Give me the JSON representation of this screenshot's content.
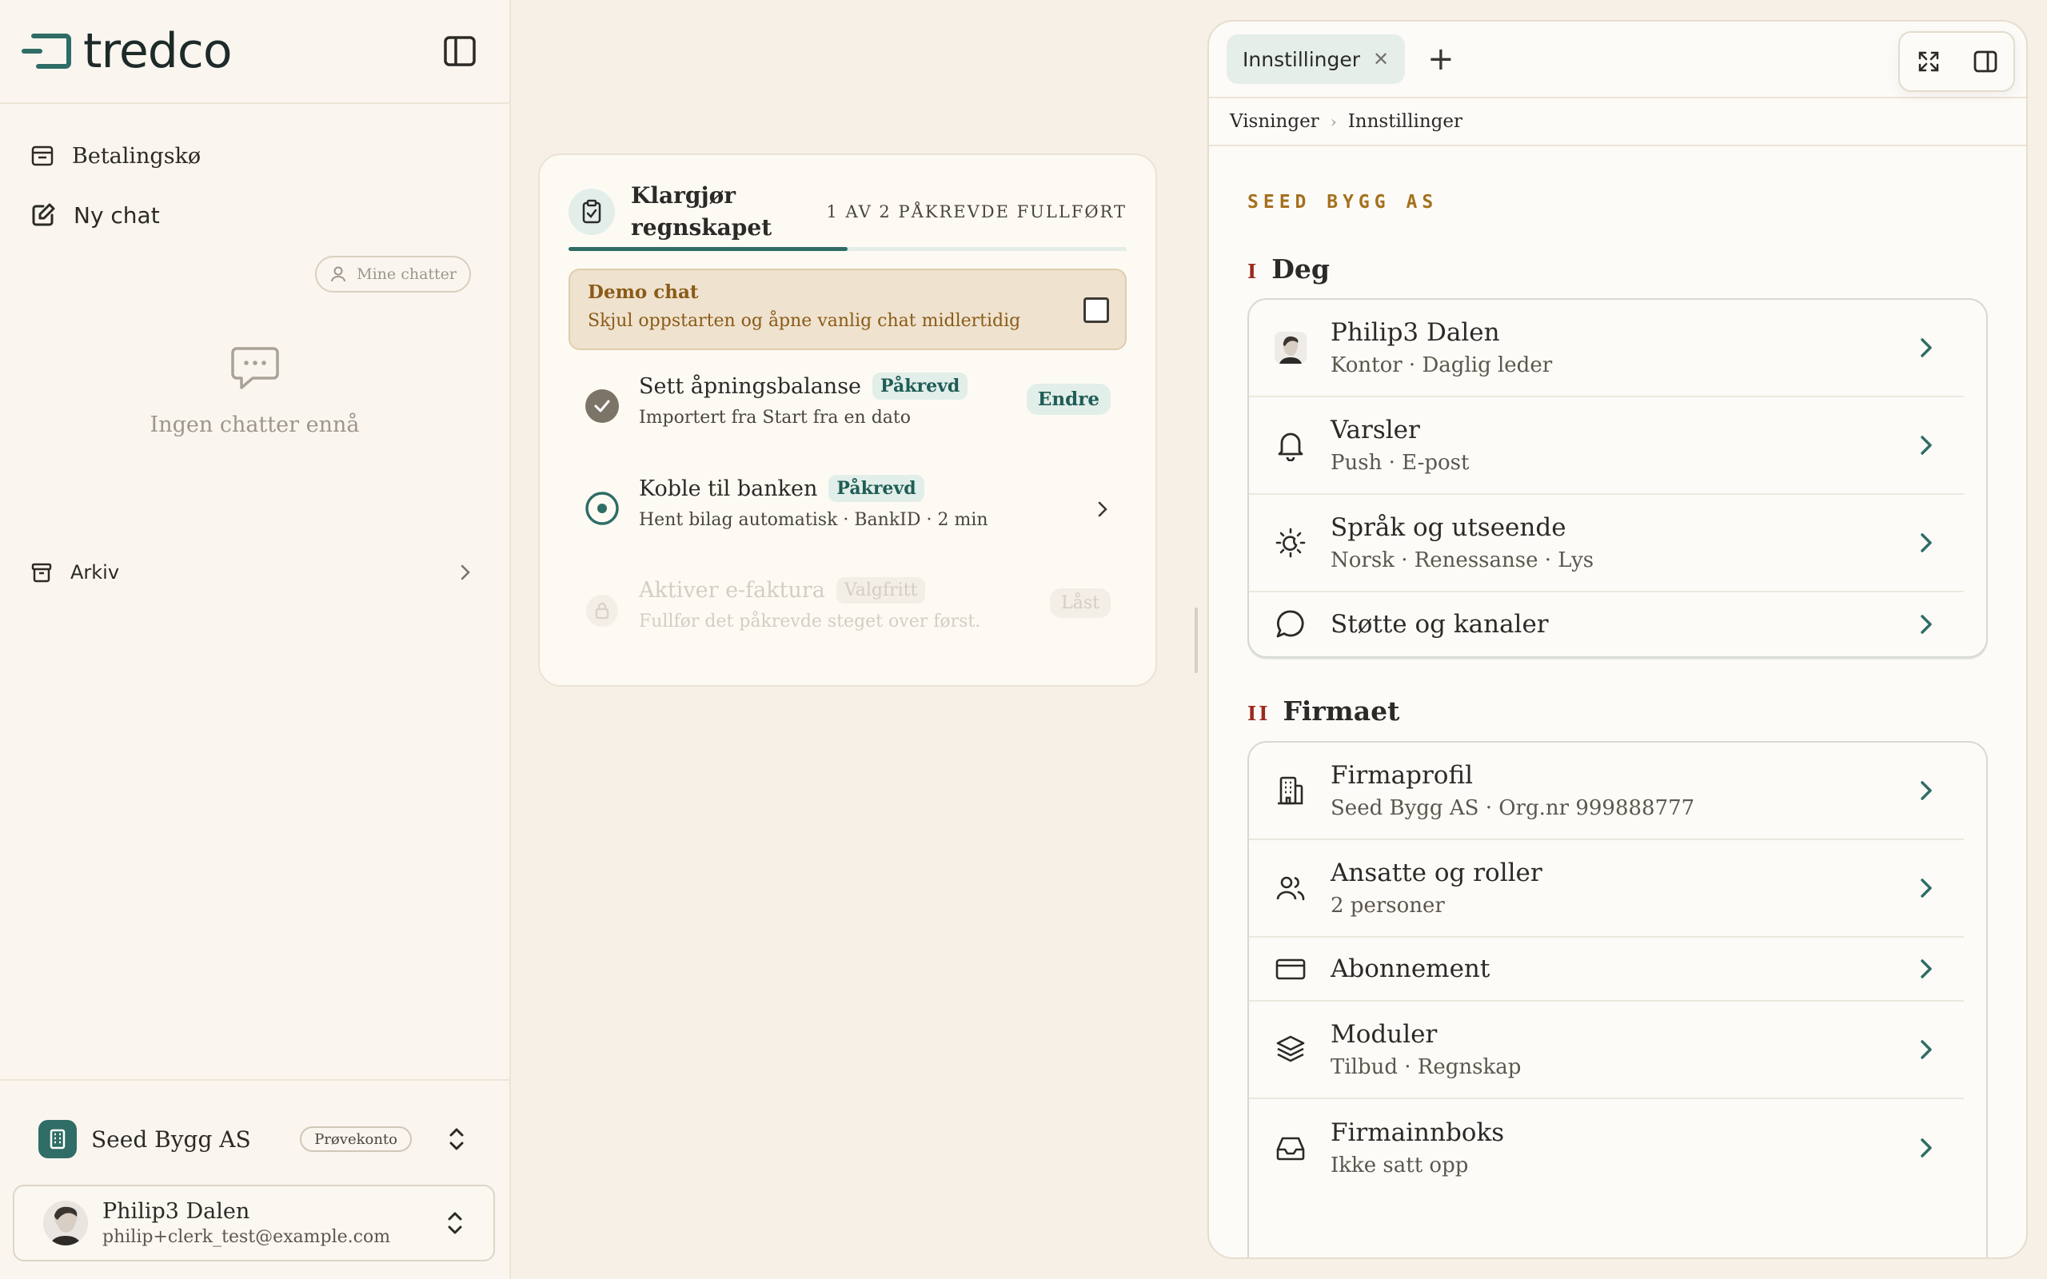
{
  "sidebar": {
    "brand": "tredco",
    "nav": {
      "payment_queue": "Betalingskø",
      "new_chat": "Ny chat"
    },
    "my_chats": "Mine chatter",
    "empty_state": "Ingen chatter ennå",
    "archive": "Arkiv",
    "company": {
      "name": "Seed Bygg AS",
      "badge": "Prøvekonto"
    },
    "user": {
      "name": "Philip3 Dalen",
      "email": "philip+clerk_test@example.com"
    }
  },
  "onboarding": {
    "title": "Klargjør regnskapet",
    "progress_text": "1 AV 2 PÅKREVDE FULLFØRT",
    "progress": 0.5,
    "demo": {
      "title": "Demo chat",
      "subtitle": "Skjul oppstarten og åpne vanlig chat midlertidig",
      "checked": false
    },
    "steps": [
      {
        "title": "Sett åpningsbalanse",
        "badge": "Påkrevd",
        "subtitle": "Importert fra Start fra en dato",
        "action": "Endre",
        "status": "done"
      },
      {
        "title": "Koble til banken",
        "badge": "Påkrevd",
        "subtitle": "Hent bilag automatisk · BankID · 2 min",
        "status": "current"
      },
      {
        "title": "Aktiver e-faktura",
        "badge": "Valgfritt",
        "subtitle": "Fullfør det påkrevde steget over først.",
        "action": "Låst",
        "status": "locked"
      }
    ]
  },
  "settings": {
    "tab_label": "Innstillinger",
    "breadcrumb": [
      "Visninger",
      "Innstillinger"
    ],
    "org_label": "SEED BYGG AS",
    "sections": [
      {
        "numeral": "I",
        "title": "Deg",
        "rows": [
          {
            "icon": "avatar-icon",
            "title": "Philip3 Dalen",
            "subtitle": "Kontor · Daglig leder"
          },
          {
            "icon": "bell-icon",
            "title": "Varsler",
            "subtitle": "Push · E-post"
          },
          {
            "icon": "sun-moon-icon",
            "title": "Språk og utseende",
            "subtitle": "Norsk · Renessanse · Lys"
          },
          {
            "icon": "message-circle-icon",
            "title": "Støtte og kanaler",
            "subtitle": ""
          }
        ]
      },
      {
        "numeral": "II",
        "title": "Firmaet",
        "rows": [
          {
            "icon": "building-icon",
            "title": "Firmaprofil",
            "subtitle": "Seed Bygg AS · Org.nr 999888777"
          },
          {
            "icon": "users-icon",
            "title": "Ansatte og roller",
            "subtitle": "2 personer"
          },
          {
            "icon": "credit-card-icon",
            "title": "Abonnement",
            "subtitle": ""
          },
          {
            "icon": "layers-icon",
            "title": "Moduler",
            "subtitle": "Tilbud · Regnskap"
          },
          {
            "icon": "inbox-icon",
            "title": "Firmainnboks",
            "subtitle": "Ikke satt opp"
          }
        ]
      }
    ]
  },
  "colors": {
    "accent": "#2f6d66",
    "background": "#f6f0e6",
    "demo_bg": "#efe2cf",
    "org_label": "#a5701e",
    "numeral": "#9b2a1e"
  }
}
